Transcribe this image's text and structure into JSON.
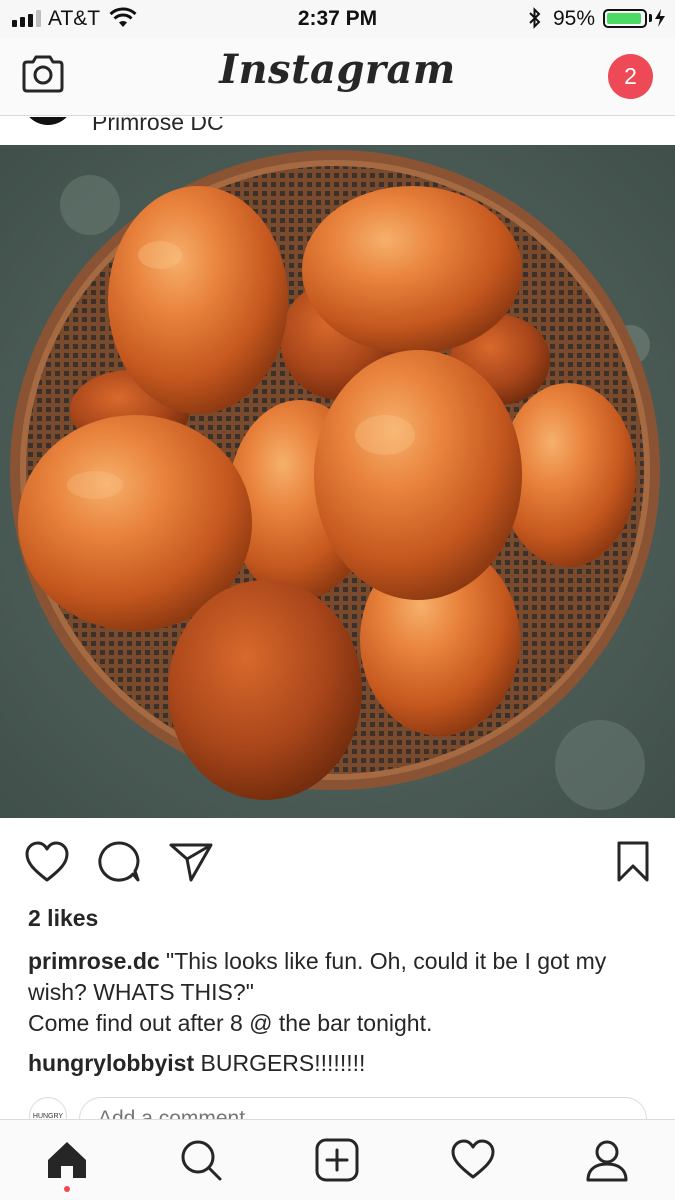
{
  "status_bar": {
    "carrier": "AT&T",
    "time": "2:37 PM",
    "battery_percent": "95%",
    "battery_level": 0.95,
    "battery_color": "#4cd964",
    "icons": [
      "signal-icon",
      "wifi-icon",
      "bluetooth-icon",
      "battery-icon",
      "charging-icon"
    ]
  },
  "header": {
    "logo": "Instagram",
    "notification_count": "2",
    "badge_color": "#ed4956",
    "icons": [
      "camera-icon"
    ]
  },
  "post": {
    "username": "Primrose DC",
    "image_alt_subject": "bread-buns-in-wicker-basket",
    "likes": "2 likes",
    "caption_user": "primrose.dc",
    "caption_text": " \"This looks like fun.  Oh, could it be I got my wish?  WHATS THIS?\"",
    "caption_line2": "Come find out after 8 @ the bar tonight.",
    "comments": [
      {
        "user": "hungrylobbyist",
        "text": " BURGERS!!!!!!!!"
      }
    ],
    "commenter_avatar_text": "HUNGRY",
    "add_comment_placeholder": "Add a comment...",
    "icons": [
      "heart-icon",
      "comment-icon",
      "share-icon",
      "bookmark-icon"
    ]
  },
  "tabbar": {
    "icons": [
      "home-icon",
      "search-icon",
      "add-post-icon",
      "activity-heart-icon",
      "profile-icon"
    ],
    "active": "home-icon"
  }
}
